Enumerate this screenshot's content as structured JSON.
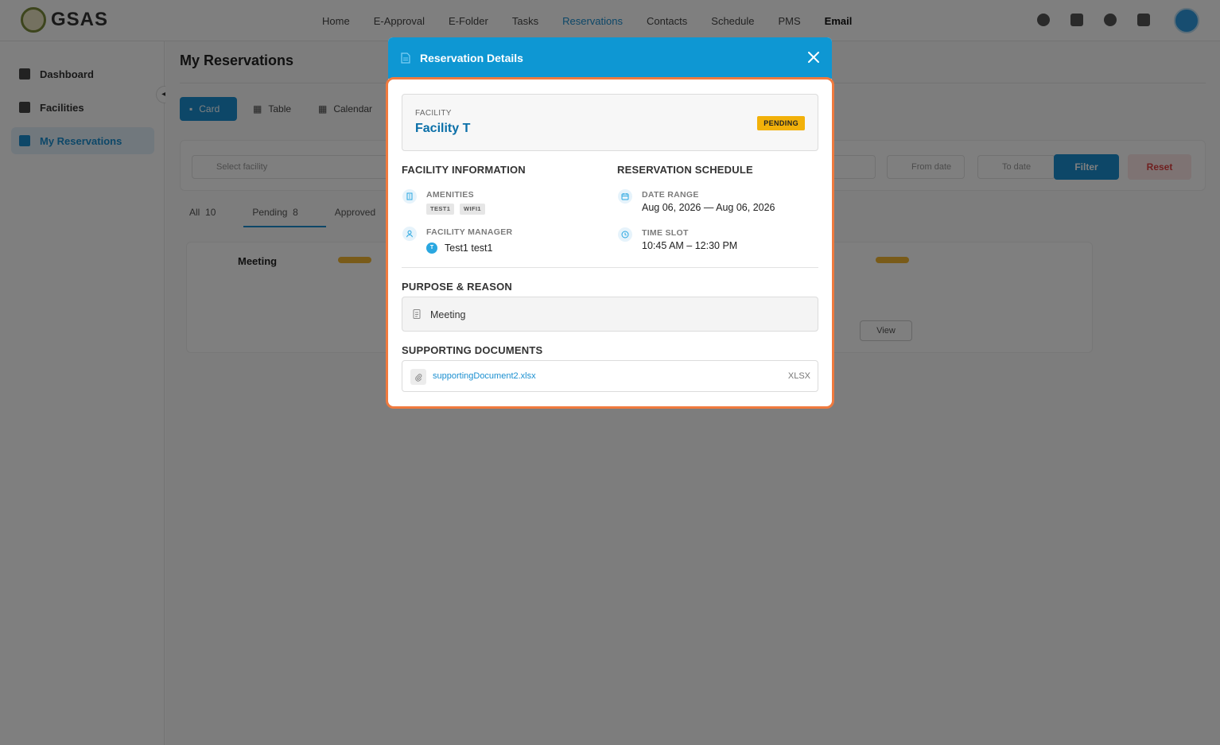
{
  "app": {
    "logo_text": "GSAS",
    "nav": [
      "Home",
      "E-Approval",
      "E-Folder",
      "Tasks",
      "Reservations",
      "Contacts",
      "Schedule",
      "PMS",
      "Email"
    ],
    "nav_active": "Reservations"
  },
  "sidebar": {
    "items": [
      {
        "label": "Dashboard"
      },
      {
        "label": "Facilities"
      },
      {
        "label": "My Reservations"
      }
    ]
  },
  "main": {
    "title": "My Reservations",
    "view_buttons": [
      "Card",
      "Table",
      "Calendar"
    ],
    "filters": {
      "facility_placeholder": "Select facility",
      "from_date_placeholder": "From date",
      "to_date_placeholder": "To date",
      "filter_label": "Filter",
      "reset_label": "Reset"
    },
    "tabs": [
      {
        "label": "All",
        "count": "10"
      },
      {
        "label": "Pending",
        "count": "8"
      },
      {
        "label": "Approved"
      }
    ],
    "card": {
      "title": "Meeting",
      "view_label": "View"
    }
  },
  "modal": {
    "title": "Reservation Details",
    "facility_label": "FACILITY",
    "facility_name": "Facility T",
    "status": "PENDING",
    "facility_info_title": "FACILITY INFORMATION",
    "amenities_label": "AMENITIES",
    "amenities": [
      "TEST1",
      "WIFI1"
    ],
    "manager_label": "FACILITY MANAGER",
    "manager_initial": "T",
    "manager_name": "Test1 test1",
    "schedule_title": "RESERVATION SCHEDULE",
    "date_range_label": "DATE RANGE",
    "date_range": "Aug 06, 2026 — Aug 06, 2026",
    "time_slot_label": "TIME SLOT",
    "time_slot": "10:45 AM – 12:30 PM",
    "purpose_title": "PURPOSE & REASON",
    "purpose": "Meeting",
    "documents_title": "SUPPORTING DOCUMENTS",
    "documents": [
      {
        "name": "supportingDocument2.xlsx",
        "ext": "XLSX"
      }
    ]
  },
  "colors": {
    "header": "#0e97d3",
    "accent": "#1a8fd0",
    "facility_name": "#0a6fa8",
    "pending_badge": "#f2b10a",
    "highlight_border": "#f07a3e"
  }
}
